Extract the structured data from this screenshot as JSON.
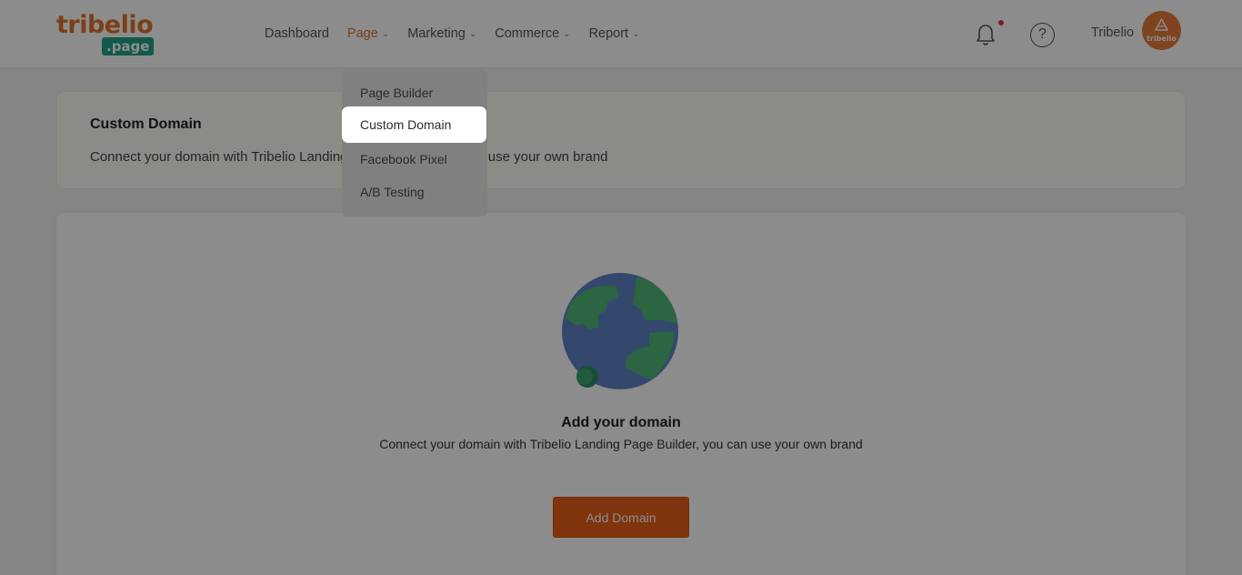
{
  "brand": {
    "logo_top": "tribelio",
    "logo_bottom": ".page"
  },
  "nav": {
    "items": [
      {
        "label": "Dashboard",
        "has_chevron": false
      },
      {
        "label": "Page",
        "has_chevron": true,
        "active": true
      },
      {
        "label": "Marketing",
        "has_chevron": true
      },
      {
        "label": "Commerce",
        "has_chevron": true
      },
      {
        "label": "Report",
        "has_chevron": true
      }
    ],
    "chevron": "⌄"
  },
  "header": {
    "help_glyph": "?",
    "user_name": "Tribelio",
    "avatar_text": "tribelio"
  },
  "dropdown": {
    "items": [
      "Page Builder",
      "Custom Domain",
      "Facebook Pixel",
      "A/B Testing"
    ],
    "highlighted": "Custom Domain"
  },
  "info_card": {
    "title": "Custom Domain",
    "description": "Connect your domain with Tribelio Landing Page Builder, you can use your own brand"
  },
  "empty_state": {
    "icon": "globe-icon",
    "title": "Add your domain",
    "description": "Connect your domain with Tribelio Landing Page Builder, you can use your own brand",
    "button_label": "Add Domain"
  },
  "colors": {
    "brand_orange": "#e0732b",
    "brand_green": "#1fa384",
    "button": "#e85f18",
    "overlay": "rgba(0,0,0,0.45)"
  }
}
